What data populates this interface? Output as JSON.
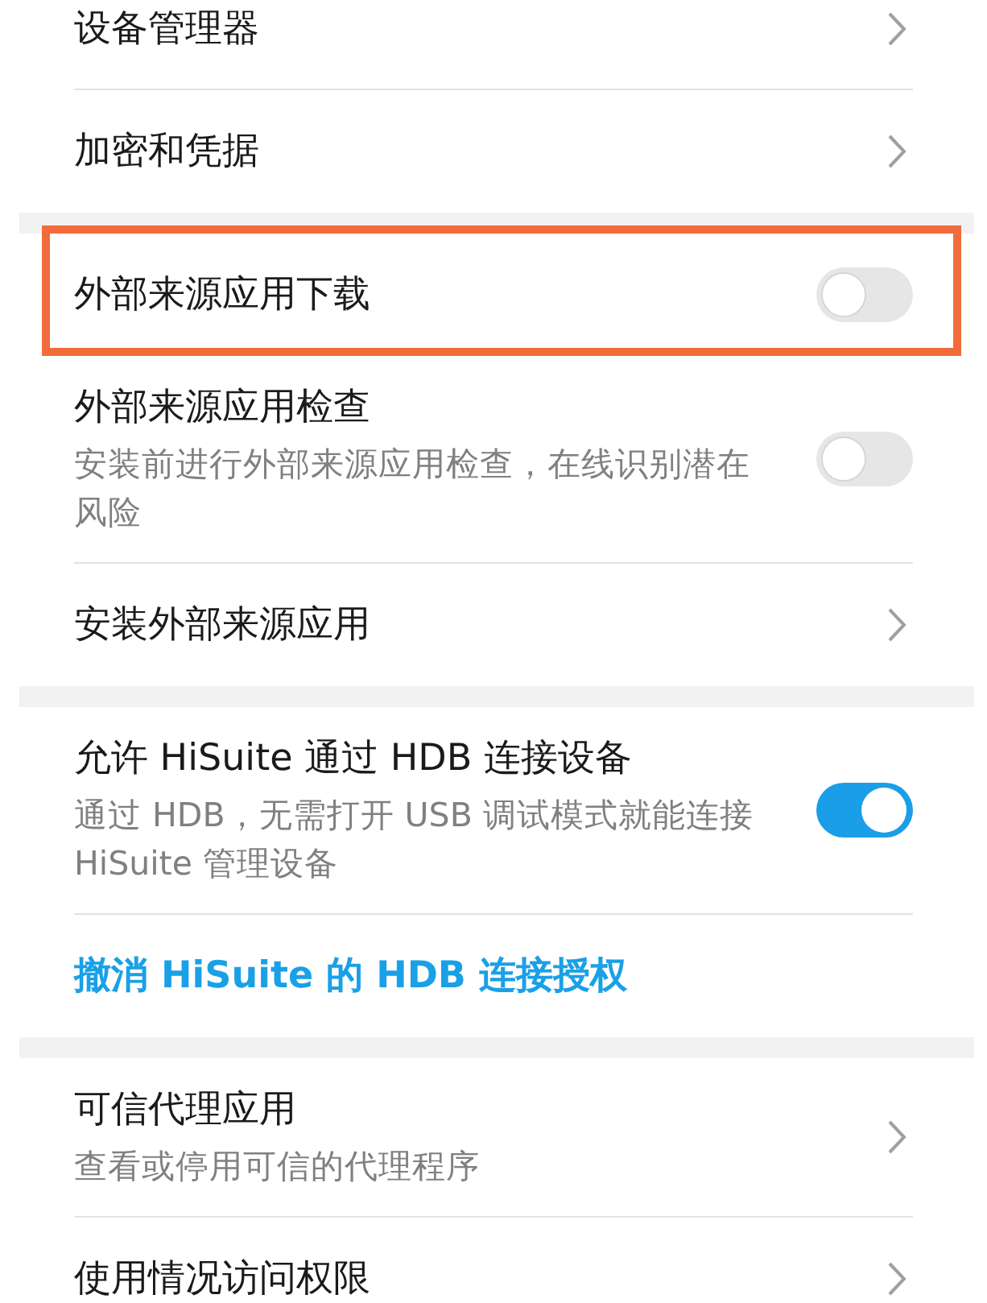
{
  "groups": [
    {
      "items": [
        {
          "kind": "chevron",
          "title": "设备管理器"
        },
        {
          "kind": "chevron",
          "title": "加密和凭据"
        }
      ]
    },
    {
      "items": [
        {
          "kind": "toggle",
          "title": "外部来源应用下载",
          "on": false,
          "highlighted": true
        },
        {
          "kind": "toggle",
          "title": "外部来源应用检查",
          "subtitle": "安装前进行外部来源应用检查，在线识别潜在风险",
          "on": false,
          "highlighted": false
        },
        {
          "kind": "chevron",
          "title": "安装外部来源应用"
        }
      ]
    },
    {
      "items": [
        {
          "kind": "toggle",
          "title": "允许 HiSuite 通过 HDB 连接设备",
          "subtitle": "通过 HDB，无需打开 USB 调试模式就能连接 HiSuite 管理设备",
          "on": true,
          "highlighted": false
        },
        {
          "kind": "link",
          "title": "撤消 HiSuite 的 HDB 连接授权"
        }
      ]
    },
    {
      "items": [
        {
          "kind": "chevron",
          "title": "可信代理应用",
          "subtitle": "查看或停用可信的代理程序"
        },
        {
          "kind": "chevron",
          "title": "使用情况访问权限"
        }
      ]
    }
  ]
}
